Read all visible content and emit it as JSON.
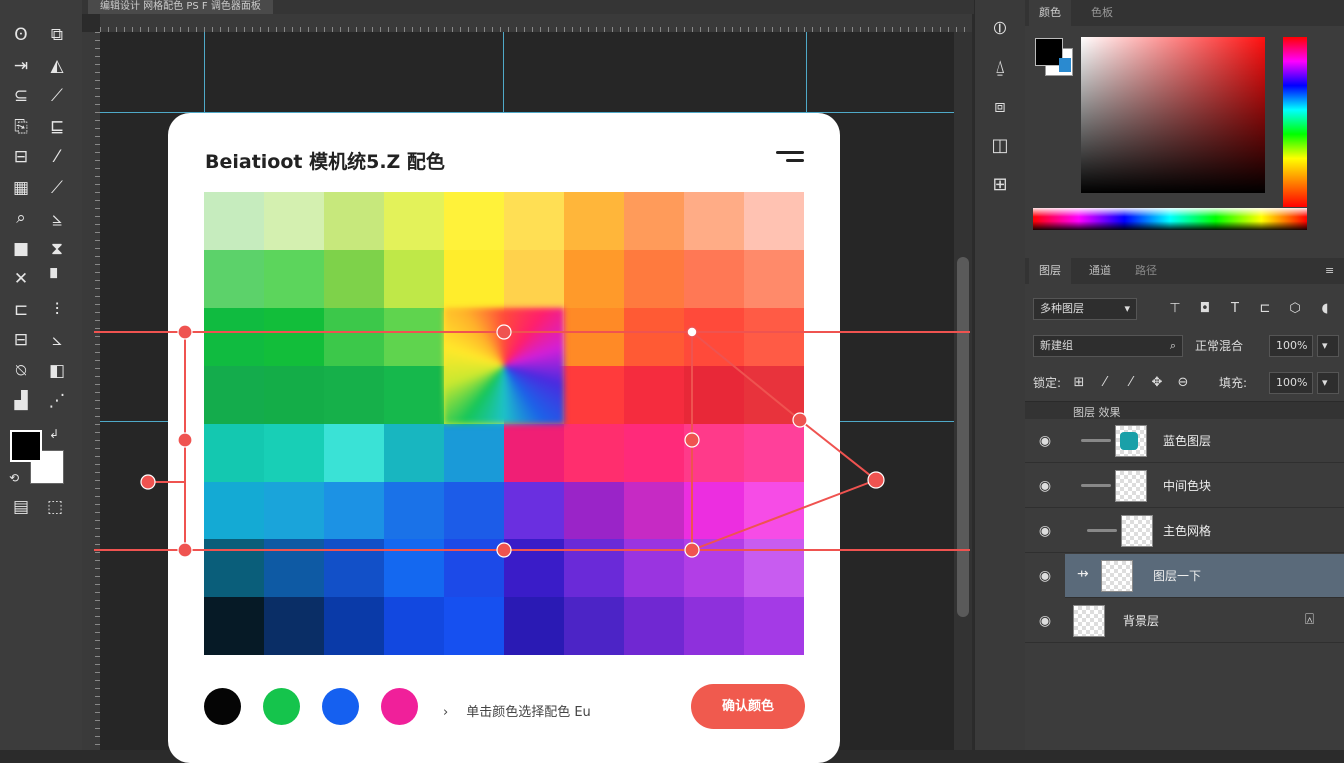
{
  "document": {
    "tab_label": "编辑设计 网格配色 PS F 调色器面板"
  },
  "toolbar": {
    "tools": [
      {
        "name": "lasso-tool",
        "glyph": "ʘ"
      },
      {
        "name": "crop-tool",
        "glyph": "⧉"
      },
      {
        "name": "move-tool",
        "glyph": "⇥"
      },
      {
        "name": "fill-tool",
        "glyph": "◭"
      },
      {
        "name": "path-tool",
        "glyph": "⊆"
      },
      {
        "name": "brush-tool",
        "glyph": "⟋"
      },
      {
        "name": "stamp-tool",
        "glyph": "⎘"
      },
      {
        "name": "healing-tool",
        "glyph": "⊑"
      },
      {
        "name": "eraser-tool",
        "glyph": "⊟"
      },
      {
        "name": "pen-tool",
        "glyph": "⁄"
      },
      {
        "name": "dodge-tool",
        "glyph": "▦"
      },
      {
        "name": "type-tool",
        "glyph": "⟋"
      },
      {
        "name": "shape-tool",
        "glyph": "⌕"
      },
      {
        "name": "smudge-tool",
        "glyph": "⦥"
      },
      {
        "name": "rectangle-tool",
        "glyph": "■"
      },
      {
        "name": "hand-tool",
        "glyph": "⧗"
      },
      {
        "name": "transform-tool",
        "glyph": "✕"
      },
      {
        "name": "note-tool",
        "glyph": "▘"
      },
      {
        "name": "select-tool",
        "glyph": "⊏"
      },
      {
        "name": "measure-tool",
        "glyph": "⫶"
      },
      {
        "name": "text-tool",
        "glyph": "⊟"
      },
      {
        "name": "sample-tool",
        "glyph": "⦣"
      },
      {
        "name": "gradient-tool",
        "glyph": "⍉"
      },
      {
        "name": "blur-tool",
        "glyph": "◧"
      },
      {
        "name": "sponge-tool",
        "glyph": "▟"
      },
      {
        "name": "zoom-tool",
        "glyph": "⋰"
      }
    ],
    "foreground_color": "#000000",
    "background_color": "#ffffff",
    "swap_glyph": "↲",
    "reset_glyph": "⟲",
    "quickmask_glyphs": [
      "▤",
      "⬚"
    ]
  },
  "card": {
    "title": "Beiatioot 模机统5.Z 配色",
    "menu_icon": "hamburger-icon",
    "hint": "单击颜色选择配色 Eu",
    "hint_arrow": "›",
    "confirm_label": "确认颜色",
    "accent_color": "#f05a4e",
    "swatch_colors": [
      "#050505",
      "#15c44c",
      "#1560f0",
      "#f0209a"
    ]
  },
  "palette_grid": {
    "rows": [
      [
        "#c6ecbe",
        "#d4f0b0",
        "#c7e87c",
        "#e3f25a",
        "#fff23a",
        "#ffdf54",
        "#ffb63a",
        "#ff9b5a",
        "#ffac86",
        "#ffc2b2"
      ],
      [
        "#5cd26a",
        "#5cd55c",
        "#7ed24a",
        "#bfe848",
        "#ffed2c",
        "#ffd24c",
        "#ff9a2a",
        "#ff7a3e",
        "#ff7855",
        "#ff8a6a"
      ],
      [
        "#10bb40",
        "#12be3a",
        "#3cc84a",
        "#5fd44e",
        "#ffe42c",
        "#ffb84a",
        "#ff8a26",
        "#ff5a34",
        "#ff4a3a",
        "#ff5b45"
      ],
      [
        "#14ac4c",
        "#14ad48",
        "#16b04a",
        "#16b84c",
        "#d8e836",
        "#ff5a3a",
        "#ff3b3c",
        "#f52c3e",
        "#e82838",
        "#e8333c"
      ],
      [
        "#14c8b0",
        "#18cfb6",
        "#3ae2d6",
        "#18b6c0",
        "#1a9ad8",
        "#f01f75",
        "#ff2e6e",
        "#ff2a7a",
        "#ff3a8a",
        "#ff409a"
      ],
      [
        "#14aad4",
        "#1aa4da",
        "#1c92e4",
        "#1a72e8",
        "#1c5ce8",
        "#6a2fe0",
        "#9a24c8",
        "#c62ac4",
        "#ec2ee0",
        "#f64ce6"
      ],
      [
        "#0a5e7a",
        "#0e5aa4",
        "#1250c8",
        "#1468f0",
        "#1c4ae8",
        "#3a1cc8",
        "#6a2ad8",
        "#9a34e0",
        "#b23ee6",
        "#c85cf0"
      ],
      [
        "#061a26",
        "#0a2e66",
        "#0a3aa8",
        "#1248e0",
        "#1650f0",
        "#2a1ab4",
        "#4c24c6",
        "#7028d2",
        "#8e30dc",
        "#a43ae6"
      ]
    ]
  },
  "dock": {
    "buttons": [
      {
        "name": "history-panel-button",
        "glyph": "⦶"
      },
      {
        "name": "properties-panel-button",
        "glyph": "⍙"
      },
      {
        "name": "adjustments-panel-button",
        "glyph": "⧈"
      },
      {
        "name": "info-panel-button",
        "glyph": "◫"
      },
      {
        "name": "channels-panel-button",
        "glyph": "⊞"
      }
    ]
  },
  "color_panel": {
    "tabs": [
      "颜色",
      "色板"
    ],
    "foreground": "#000000",
    "background": "#ffffff",
    "base_hue": "#ff1010"
  },
  "layers_panel": {
    "tabs": [
      "图层",
      "通道",
      "路径"
    ],
    "menu_glyph": "≡",
    "filter_kind": "多种图层",
    "filter_icons": [
      "⊤",
      "◘",
      "T",
      "⊏",
      "⬡",
      "◖"
    ],
    "search_placeholder": "新建组",
    "search_icon_glyph": "⌕",
    "blend_label": "正常混合",
    "opacity_value": "100%",
    "lock_label": "锁定:",
    "lock_icons": [
      "⊞",
      "⁄",
      "⁄",
      "✥",
      "⊖"
    ],
    "fill_label": "填充:",
    "fill_value": "100%",
    "group_header": "图层 效果",
    "layers": [
      {
        "name": "蓝色图层",
        "has_teal_thumb": true,
        "selected": false
      },
      {
        "name": "中间色块",
        "has_teal_thumb": false,
        "selected": false
      },
      {
        "name": "主色网格",
        "has_teal_thumb": false,
        "selected": false
      },
      {
        "name": "图层一下",
        "has_teal_thumb": false,
        "selected": true
      },
      {
        "name": "背景层",
        "has_teal_thumb": false,
        "selected": false,
        "locked": true
      }
    ],
    "lock_glyph": "⍓",
    "eye_glyph": "◉",
    "link_glyph": "⇸"
  }
}
